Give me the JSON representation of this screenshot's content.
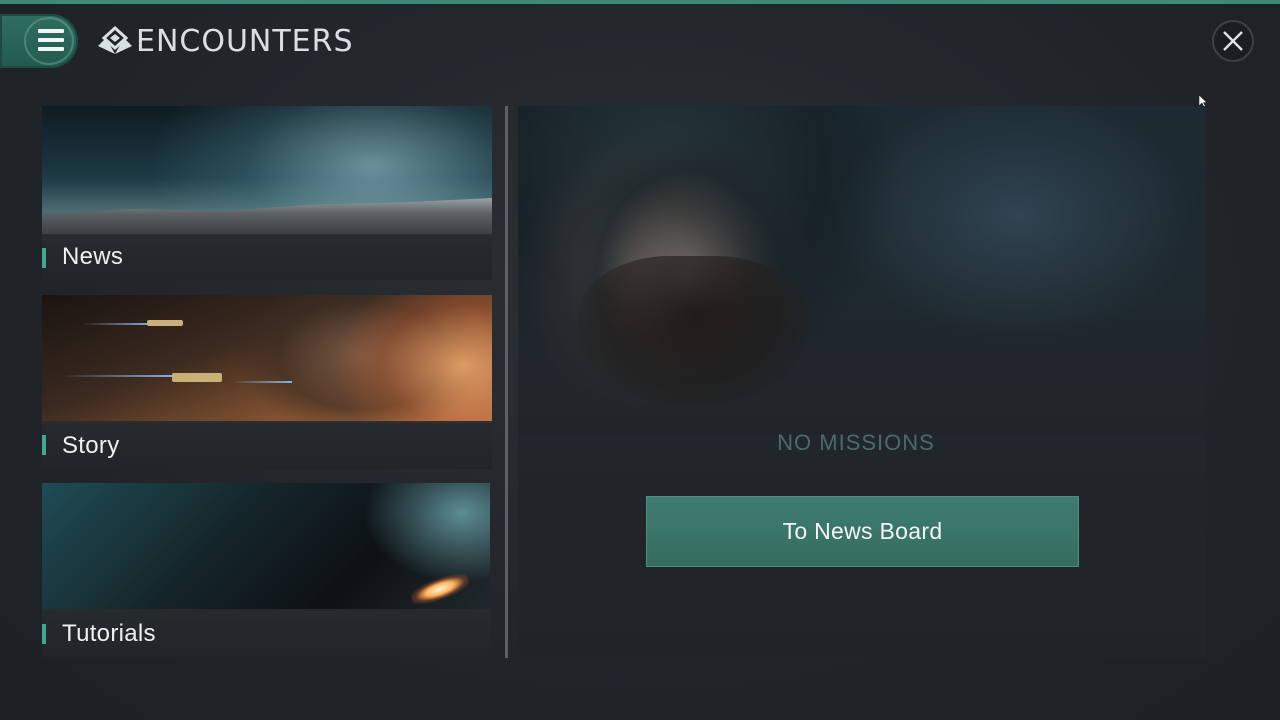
{
  "header": {
    "title": "ENCOUNTERS",
    "menu_icon": "hamburger-menu-icon",
    "logo_icon": "encounters-logo-icon",
    "close_icon": "close-icon"
  },
  "sidebar": {
    "items": [
      {
        "label": "News",
        "image": "space-station-planet-image"
      },
      {
        "label": "Story",
        "image": "ships-asteroid-image"
      },
      {
        "label": "Tutorials",
        "image": "ship-thruster-image"
      }
    ]
  },
  "main": {
    "status_text": "NO MISSIONS",
    "action_label": "To News Board",
    "hero_image": "hooded-bearded-man-image"
  },
  "colors": {
    "accent": "#3e8a79",
    "button": "#3a7568",
    "marker": "#3ea890",
    "status_text": "#4e6a68",
    "background": "#22262b"
  }
}
